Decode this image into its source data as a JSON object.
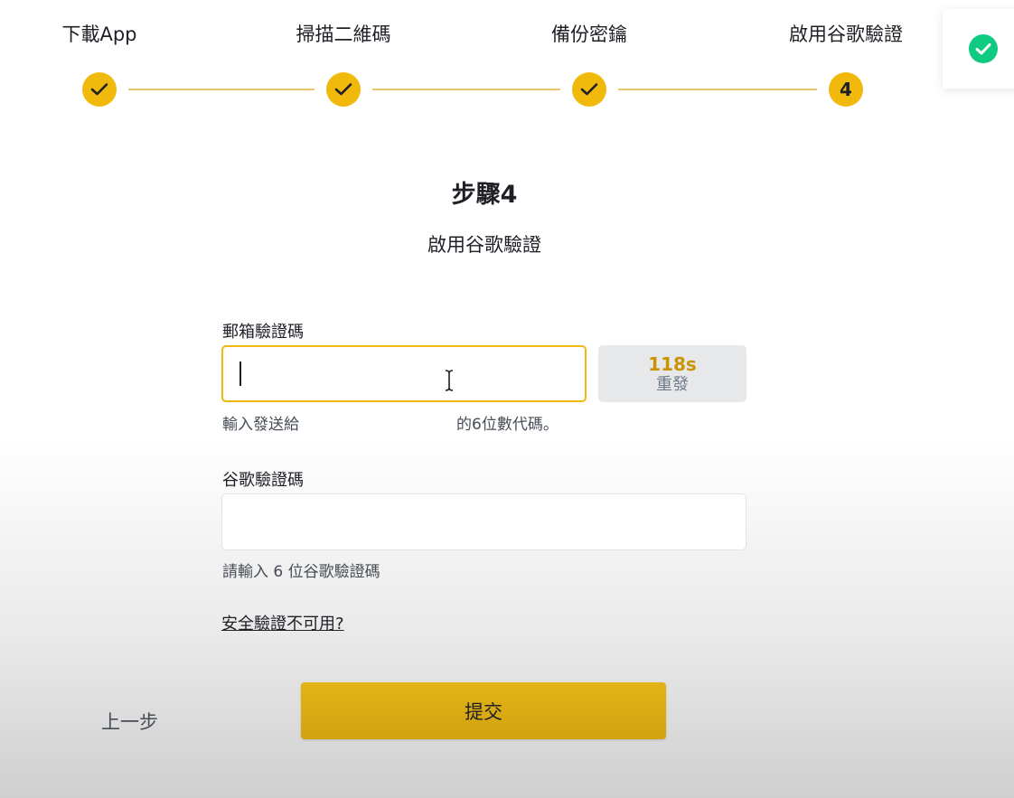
{
  "steps": [
    {
      "label": "下載App",
      "status": "done",
      "number": "1"
    },
    {
      "label": "掃描二維碼",
      "status": "done",
      "number": "2"
    },
    {
      "label": "備份密鑰",
      "status": "done",
      "number": "3"
    },
    {
      "label": "啟用谷歌驗證",
      "status": "current",
      "number": "4"
    }
  ],
  "toast": {
    "icon": "check-circle-icon",
    "color": "#0ecb81"
  },
  "heading": {
    "title": "步驟4",
    "subtitle": "啟用谷歌驗證"
  },
  "email_code": {
    "label": "郵箱驗證碼",
    "value": "",
    "countdown": "118s",
    "resend_label": "重發",
    "hint_prefix": "輸入發送給",
    "hint_suffix": "的6位數代碼。"
  },
  "google_code": {
    "label": "谷歌驗證碼",
    "value": "",
    "hint": "請輸入 6 位谷歌驗證碼"
  },
  "security_link": "安全驗證不可用?",
  "back_label": "上一步",
  "submit_label": "提交",
  "colors": {
    "accent": "#f0b90b",
    "success": "#0ecb81",
    "text": "#1e2026"
  }
}
